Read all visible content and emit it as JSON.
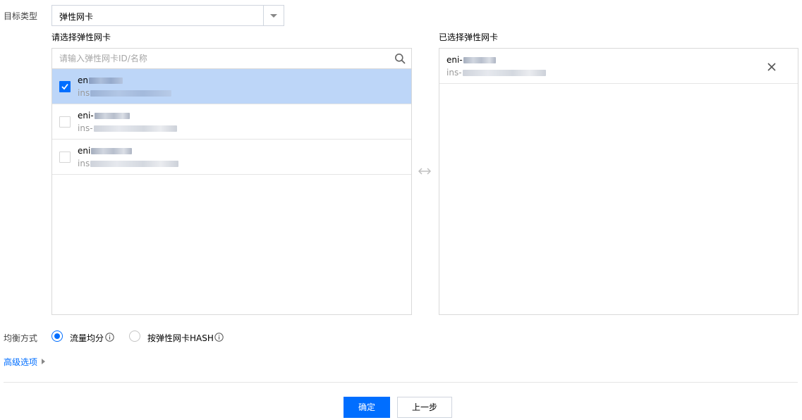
{
  "target_type": {
    "label": "目标类型",
    "selected": "弹性网卡"
  },
  "left_panel": {
    "title": "请选择弹性网卡",
    "search_placeholder": "请输入弹性网卡ID/名称",
    "items": [
      {
        "line1": "en",
        "line2": "ins",
        "checked": true
      },
      {
        "line1": "eni-",
        "line2": "ins-",
        "checked": false
      },
      {
        "line1": "eni",
        "line2": "ins",
        "checked": false
      }
    ]
  },
  "right_panel": {
    "title": "已选择弹性网卡",
    "items": [
      {
        "line1": "eni-",
        "line2": "ins-"
      }
    ]
  },
  "balance": {
    "label": "均衡方式",
    "options": [
      {
        "label": "流量均分",
        "selected": true
      },
      {
        "label": "按弹性网卡HASH",
        "selected": false
      }
    ]
  },
  "advanced": {
    "label": "高级选项"
  },
  "footer": {
    "confirm": "确定",
    "back": "上一步"
  },
  "colors": {
    "accent": "#006eff",
    "selected_row": "#bdd6f8"
  }
}
